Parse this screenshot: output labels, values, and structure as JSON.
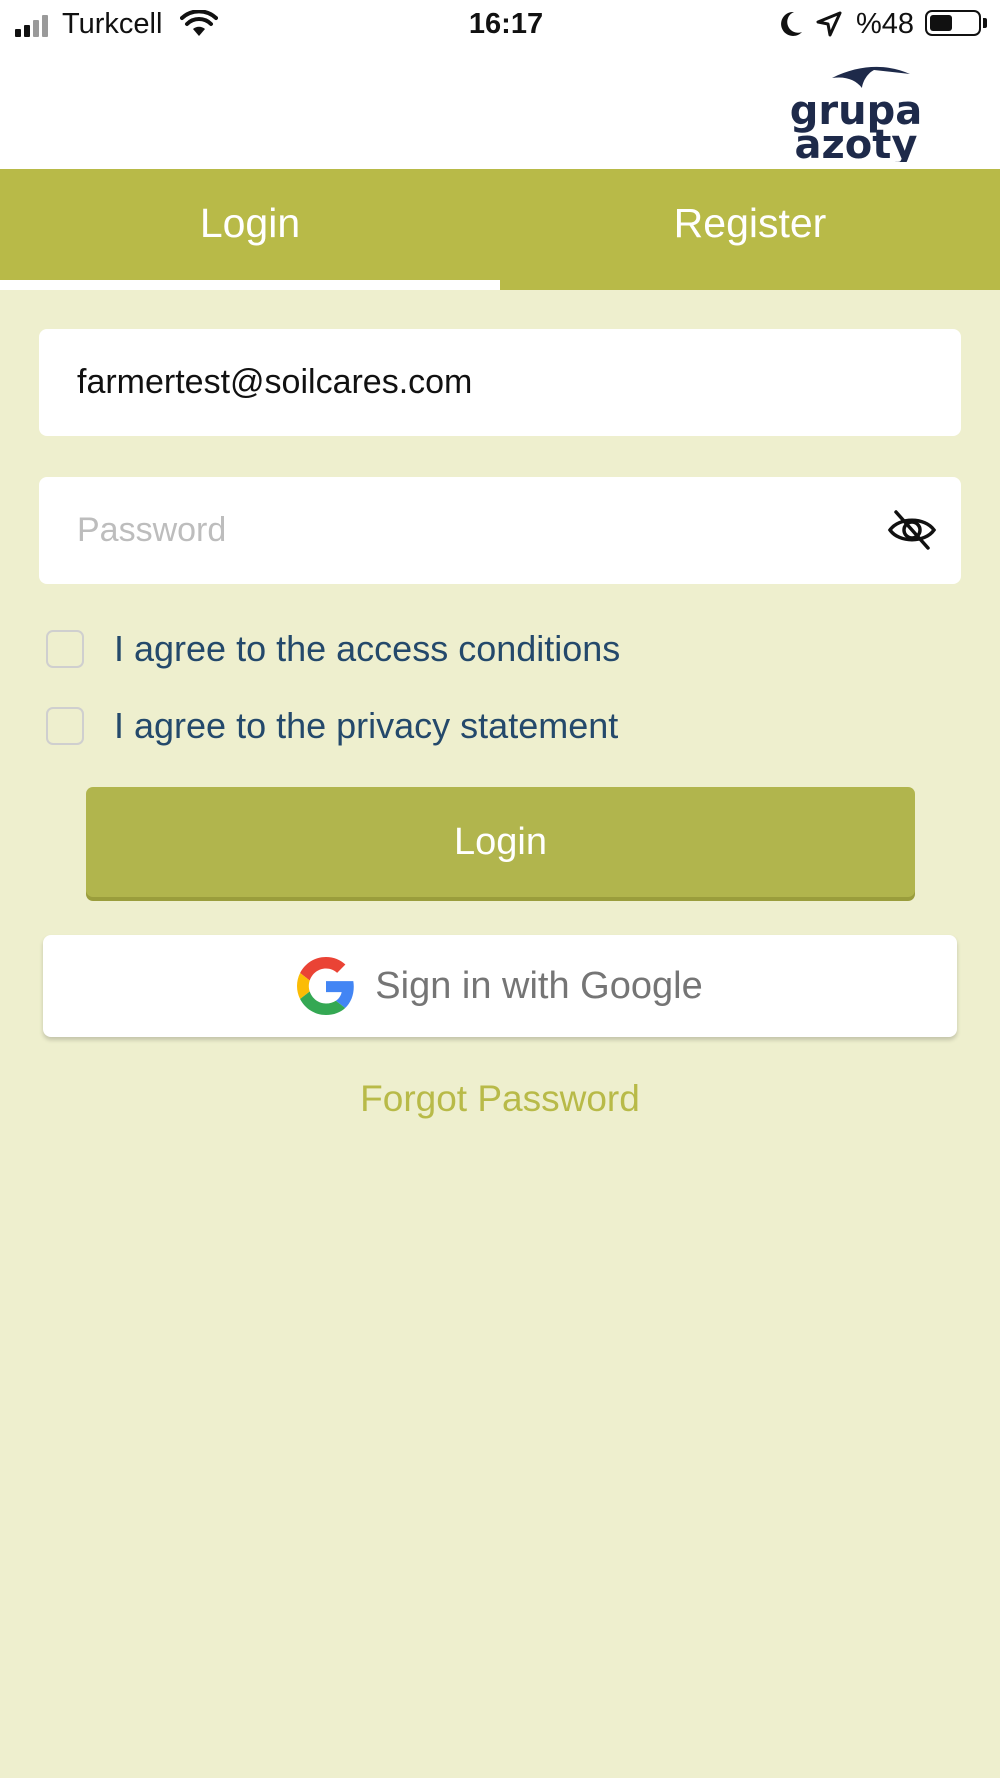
{
  "status_bar": {
    "carrier": "Turkcell",
    "time": "16:17",
    "battery_text": "%48",
    "battery_level": 0.48,
    "icons": [
      "signal-icon",
      "wifi-icon",
      "moon-icon",
      "location-arrow-icon",
      "battery-icon"
    ]
  },
  "header": {
    "logo_line1": "grupa",
    "logo_line2": "azoty"
  },
  "tabs": [
    {
      "label": "Login",
      "active": true
    },
    {
      "label": "Register",
      "active": false
    }
  ],
  "form": {
    "email_value": "farmertest@soilcares.com",
    "password_placeholder": "Password",
    "password_icon": "eye-off-icon",
    "checkbox_access": "I agree to the access conditions",
    "checkbox_privacy": "I agree to the privacy statement",
    "login_button": "Login",
    "google_button": "Sign in with Google",
    "forgot_link": "Forgot Password"
  },
  "colors": {
    "accent": "#b8ba48",
    "button": "#b1b54d",
    "background": "#eeefce",
    "label_text": "#24496b",
    "logo": "#1e2a4a"
  }
}
